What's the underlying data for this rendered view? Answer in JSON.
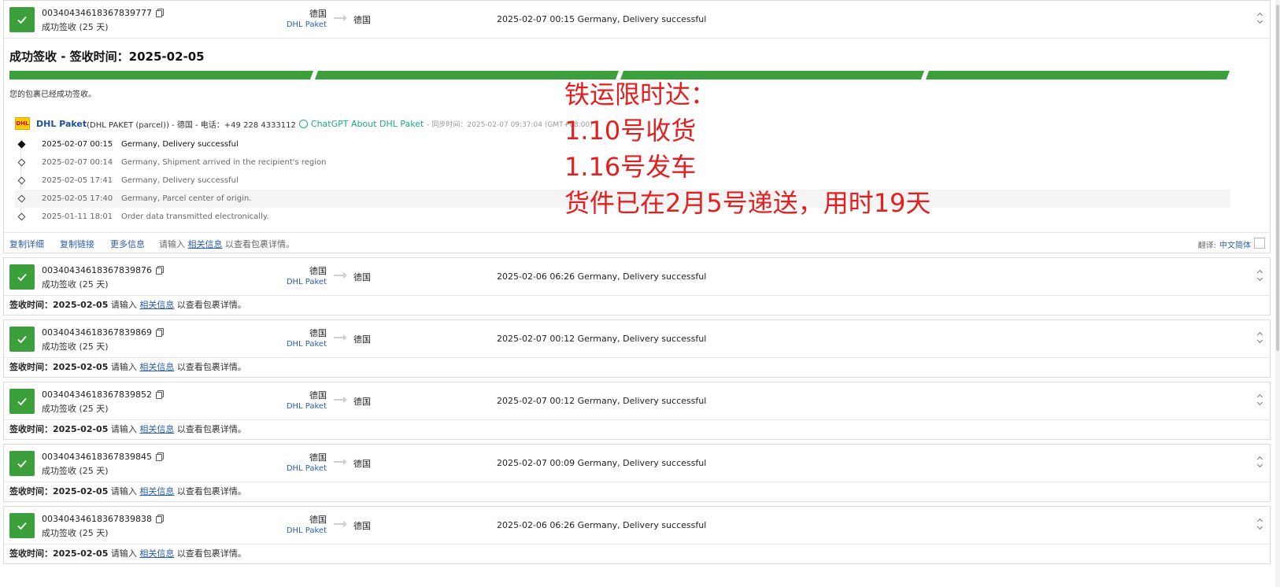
{
  "expanded": {
    "tracking": "00340434618367839777",
    "status": "成功签收 (25 天)",
    "origin": "德国",
    "carrier": "DHL Paket",
    "dest": "德国",
    "latest": "2025-02-07 00:15  Germany, Delivery successful",
    "title": "成功签收 - 签收时间：2025-02-05",
    "message": "您的包裹已经成功签收。",
    "provider": {
      "icon_text": "DHL",
      "name": "DHL Paket",
      "info": " (DHL PAKET (parcel)) - 德国 - 电话：+49 228 4333112 ",
      "gpt_link": "ChatGPT About DHL Paket",
      "sync": "- 同步时间：2025-02-07 09:37:04 (GMT+08:00)"
    },
    "events": [
      {
        "time": "2025-02-07 00:15",
        "desc": "Germany, Delivery successful"
      },
      {
        "time": "2025-02-07 00:14",
        "desc": "Germany, Shipment arrived in the recipient's region"
      },
      {
        "time": "2025-02-05 17:41",
        "desc": "Germany, Delivery successful"
      },
      {
        "time": "2025-02-05 17:40",
        "desc": "Germany, Parcel center of origin."
      },
      {
        "time": "2025-01-11 18:01",
        "desc": "Order data transmitted electronically."
      }
    ],
    "actions": {
      "copy_detail": "复制详细",
      "copy_link": "复制链接",
      "more_info": "更多信息",
      "hint_pre": "请输入 ",
      "hint_link": "相关信息",
      "hint_post": " 以查看包裹详情。",
      "translate_label": "翻译:",
      "translate_lang": "中文简体"
    }
  },
  "overlay": {
    "line1": "铁运限时达：",
    "line2": "1.10号收货",
    "line3": "1.16号发车",
    "line4": "货件已在2月5号递送，用时19天"
  },
  "foot": {
    "label": "签收时间：2025-02-05",
    "pre": " 请输入 ",
    "link": "相关信息",
    "post": " 以查看包裹详情。"
  },
  "items": [
    {
      "tracking": "00340434618367839876",
      "status": "成功签收 (25 天)",
      "origin": "德国",
      "carrier": "DHL Paket",
      "dest": "德国",
      "latest": "2025-02-06 06:26  Germany, Delivery successful"
    },
    {
      "tracking": "00340434618367839869",
      "status": "成功签收 (25 天)",
      "origin": "德国",
      "carrier": "DHL Paket",
      "dest": "德国",
      "latest": "2025-02-07 00:12  Germany, Delivery successful"
    },
    {
      "tracking": "00340434618367839852",
      "status": "成功签收 (25 天)",
      "origin": "德国",
      "carrier": "DHL Paket",
      "dest": "德国",
      "latest": "2025-02-07 00:12  Germany, Delivery successful"
    },
    {
      "tracking": "00340434618367839845",
      "status": "成功签收 (25 天)",
      "origin": "德国",
      "carrier": "DHL Paket",
      "dest": "德国",
      "latest": "2025-02-07 00:09  Germany, Delivery successful"
    },
    {
      "tracking": "00340434618367839838",
      "status": "成功签收 (25 天)",
      "origin": "德国",
      "carrier": "DHL Paket",
      "dest": "德国",
      "latest": "2025-02-06 06:26  Germany, Delivery successful"
    }
  ],
  "colors": {
    "success": "#3ba03b",
    "link": "#2a5db0",
    "annotation": "#e4201f"
  }
}
